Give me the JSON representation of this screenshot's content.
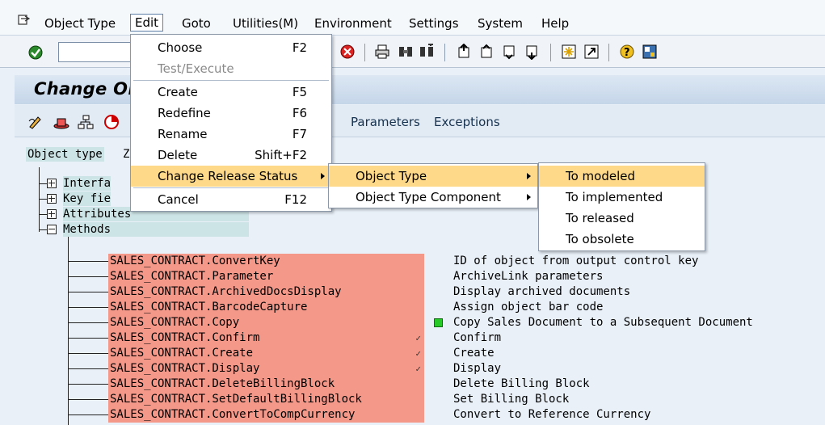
{
  "menubar": {
    "items": [
      "Object Type",
      "Edit",
      "Goto",
      "Utilities(M)",
      "Environment",
      "Settings",
      "System",
      "Help"
    ],
    "active": "Edit"
  },
  "title": "Change Obj",
  "app_toolbar": {
    "links": [
      "Parameters",
      "Exceptions"
    ]
  },
  "content": {
    "object_type_label": "Object type",
    "object_type_value": "Z",
    "tree": [
      {
        "label": "Interfa",
        "expanded": false
      },
      {
        "label": "Key fie",
        "expanded": false
      },
      {
        "label": "Attributes",
        "expanded": false
      },
      {
        "label": "Methods",
        "expanded": true
      }
    ],
    "methods": [
      {
        "name": "SALES_CONTRACT.ConvertKey",
        "desc": "ID of object from output control key",
        "check": "",
        "status": false
      },
      {
        "name": "SALES_CONTRACT.Parameter",
        "desc": "ArchiveLink parameters",
        "check": "",
        "status": false
      },
      {
        "name": "SALES_CONTRACT.ArchivedDocsDisplay",
        "desc": "Display archived documents",
        "check": "",
        "status": false
      },
      {
        "name": "SALES_CONTRACT.BarcodeCapture",
        "desc": "Assign object bar code",
        "check": "",
        "status": false
      },
      {
        "name": "SALES_CONTRACT.Copy",
        "desc": "Copy Sales Document to a Subsequent Document",
        "check": "",
        "status": true
      },
      {
        "name": "SALES_CONTRACT.Confirm",
        "desc": "Confirm",
        "check": "✓",
        "status": false
      },
      {
        "name": "SALES_CONTRACT.Create",
        "desc": "Create",
        "check": "✓",
        "status": false
      },
      {
        "name": "SALES_CONTRACT.Display",
        "desc": "Display",
        "check": "✓",
        "status": false
      },
      {
        "name": "SALES_CONTRACT.DeleteBillingBlock",
        "desc": "Delete Billing Block",
        "check": "",
        "status": false
      },
      {
        "name": "SALES_CONTRACT.SetDefaultBillingBlock",
        "desc": "Set Billing Block",
        "check": "",
        "status": false
      },
      {
        "name": "SALES_CONTRACT.ConvertToCompCurrency",
        "desc": "Convert to Reference Currency",
        "check": "",
        "status": false
      }
    ]
  },
  "edit_menu": {
    "items": [
      {
        "label": "Choose",
        "key": "F2",
        "disabled": false
      },
      {
        "label": "Test/Execute",
        "key": "",
        "disabled": true
      },
      {
        "label": "Create",
        "key": "F5",
        "disabled": false
      },
      {
        "label": "Redefine",
        "key": "F6",
        "disabled": false
      },
      {
        "label": "Rename",
        "key": "F7",
        "disabled": false
      },
      {
        "label": "Delete",
        "key": "Shift+F2",
        "disabled": false
      },
      {
        "label": "Change Release Status",
        "key": "",
        "disabled": false
      },
      {
        "label": "Cancel",
        "key": "F12",
        "disabled": false
      }
    ]
  },
  "release_submenu": {
    "items": [
      "Object Type",
      "Object Type Component"
    ]
  },
  "status_submenu": {
    "items": [
      "To modeled",
      "To implemented",
      "To released",
      "To obsolete"
    ]
  },
  "colors": {
    "highlight": "#ffd98a",
    "method_bg": "#f4988a",
    "node_bg": "#cde4e6",
    "status_green": "#28c828"
  }
}
